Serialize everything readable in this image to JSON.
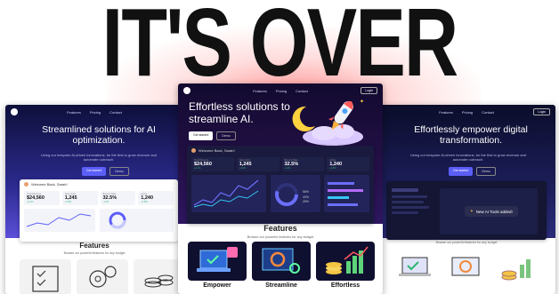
{
  "headline": "IT'S OVER",
  "nav": {
    "links": [
      "Features",
      "Pricing",
      "Contact"
    ],
    "button": "Login"
  },
  "left": {
    "title": "Streamlined solutions for AI optimization.",
    "subtitle": "Using our bespoke AI-driven innovations, be the first to grow revenue and automate outreach.",
    "cta": [
      "Get started",
      "Demo"
    ],
    "welcome": "Welcome Back, Sarah!",
    "stats": [
      {
        "label": "Total Revenue",
        "value": "$24,560",
        "delta": "+2.1%"
      },
      {
        "label": "New Users",
        "value": "1,245",
        "delta": "+4.3%"
      },
      {
        "label": "Bounce Rate",
        "value": "32.5%",
        "delta": "-1.2%"
      },
      {
        "label": "Active",
        "value": "1,240",
        "delta": "+1.8%"
      }
    ],
    "features_title": "Features",
    "features_sub": "Browse our powerful features for any budget"
  },
  "center": {
    "title": "Effortless solutions to streamline AI.",
    "cta": [
      "Get started",
      "Demo"
    ],
    "welcome": "Welcome Back, Sarah!",
    "stats": [
      {
        "label": "Total Revenue",
        "value": "$24,560",
        "delta": "+2.1%"
      },
      {
        "label": "New Users",
        "value": "1,245",
        "delta": "+4.3%"
      },
      {
        "label": "Bounce Rate",
        "value": "32.5%",
        "delta": "-1.2%"
      },
      {
        "label": "Active",
        "value": "1,240",
        "delta": "+1.8%"
      }
    ],
    "percents": [
      "56%",
      "40%",
      "25%"
    ],
    "features_title": "Features",
    "features_sub": "Browse our powerful features for any budget",
    "cards": [
      "Empower",
      "Streamline",
      "Effortless"
    ]
  },
  "right": {
    "title": "Effortlessly empower digital transformation.",
    "subtitle": "Using our bespoke AI-driven innovations, be the first to grow revenue and automate outreach.",
    "cta": [
      "Get started",
      "Demo"
    ],
    "toast": "New AI Tools added!",
    "features_sub": "Browse our powerful features for any budget"
  },
  "colors": {
    "accent": "#5b5ef7",
    "hero_dark": "#0b0d2a",
    "glow": "#ff3b3b"
  }
}
